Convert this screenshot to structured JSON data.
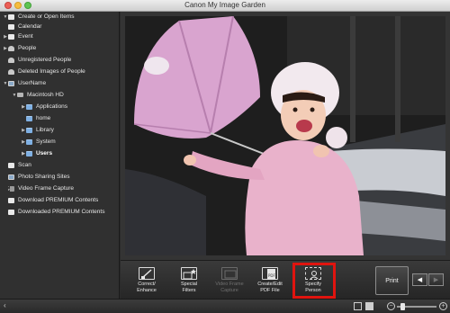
{
  "window": {
    "title": "Canon My Image Garden"
  },
  "sidebar": {
    "items": [
      {
        "label": "Create or Open Items",
        "icon": "folder-icon"
      },
      {
        "label": "Calendar",
        "icon": "calendar-icon"
      },
      {
        "label": "Event",
        "icon": "event-icon"
      },
      {
        "label": "People",
        "icon": "people-icon"
      },
      {
        "label": "Unregistered People",
        "icon": "person-icon"
      },
      {
        "label": "Deleted Images of People",
        "icon": "person-icon"
      },
      {
        "label": "UserName",
        "icon": "computer-icon"
      },
      {
        "label": "Macintosh HD",
        "icon": "hard-drive-icon"
      },
      {
        "label": "Applications",
        "icon": "folder-icon"
      },
      {
        "label": "home",
        "icon": "folder-icon"
      },
      {
        "label": "Library",
        "icon": "folder-icon"
      },
      {
        "label": "System",
        "icon": "folder-icon"
      },
      {
        "label": "Users",
        "icon": "folder-icon"
      },
      {
        "label": "Scan",
        "icon": "scan-icon"
      },
      {
        "label": "Photo Sharing Sites",
        "icon": "photo-sharing-icon"
      },
      {
        "label": "Video Frame Capture",
        "icon": "film-icon"
      },
      {
        "label": "Download PREMIUM Contents",
        "icon": "download-icon"
      },
      {
        "label": "Downloaded PREMIUM Contents",
        "icon": "downloaded-icon"
      }
    ]
  },
  "toolbar": {
    "correct_enhance": "Correct/\nEnhance",
    "special_filters": "Special\nFilters",
    "video_frame_capture": "Video Frame\nCapture",
    "create_edit_pdf": "Create/Edit\nPDF File",
    "specify_person": "Specify\nPerson",
    "print": "Print"
  },
  "colors": {
    "highlight": "#e0140f",
    "sidebar_bg": "#303030",
    "folder": "#7fb0e3"
  }
}
